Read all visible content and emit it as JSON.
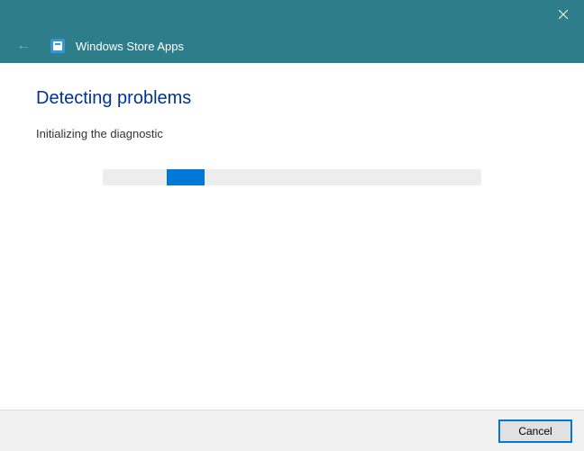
{
  "titlebar": {
    "close_tooltip": "Close"
  },
  "header": {
    "title": "Windows Store Apps",
    "icon_name": "store-icon"
  },
  "content": {
    "heading": "Detecting problems",
    "status": "Initializing the diagnostic",
    "progress": {
      "chunk_left_pct": 17,
      "chunk_width_pct": 10
    }
  },
  "footer": {
    "cancel_label": "Cancel"
  }
}
